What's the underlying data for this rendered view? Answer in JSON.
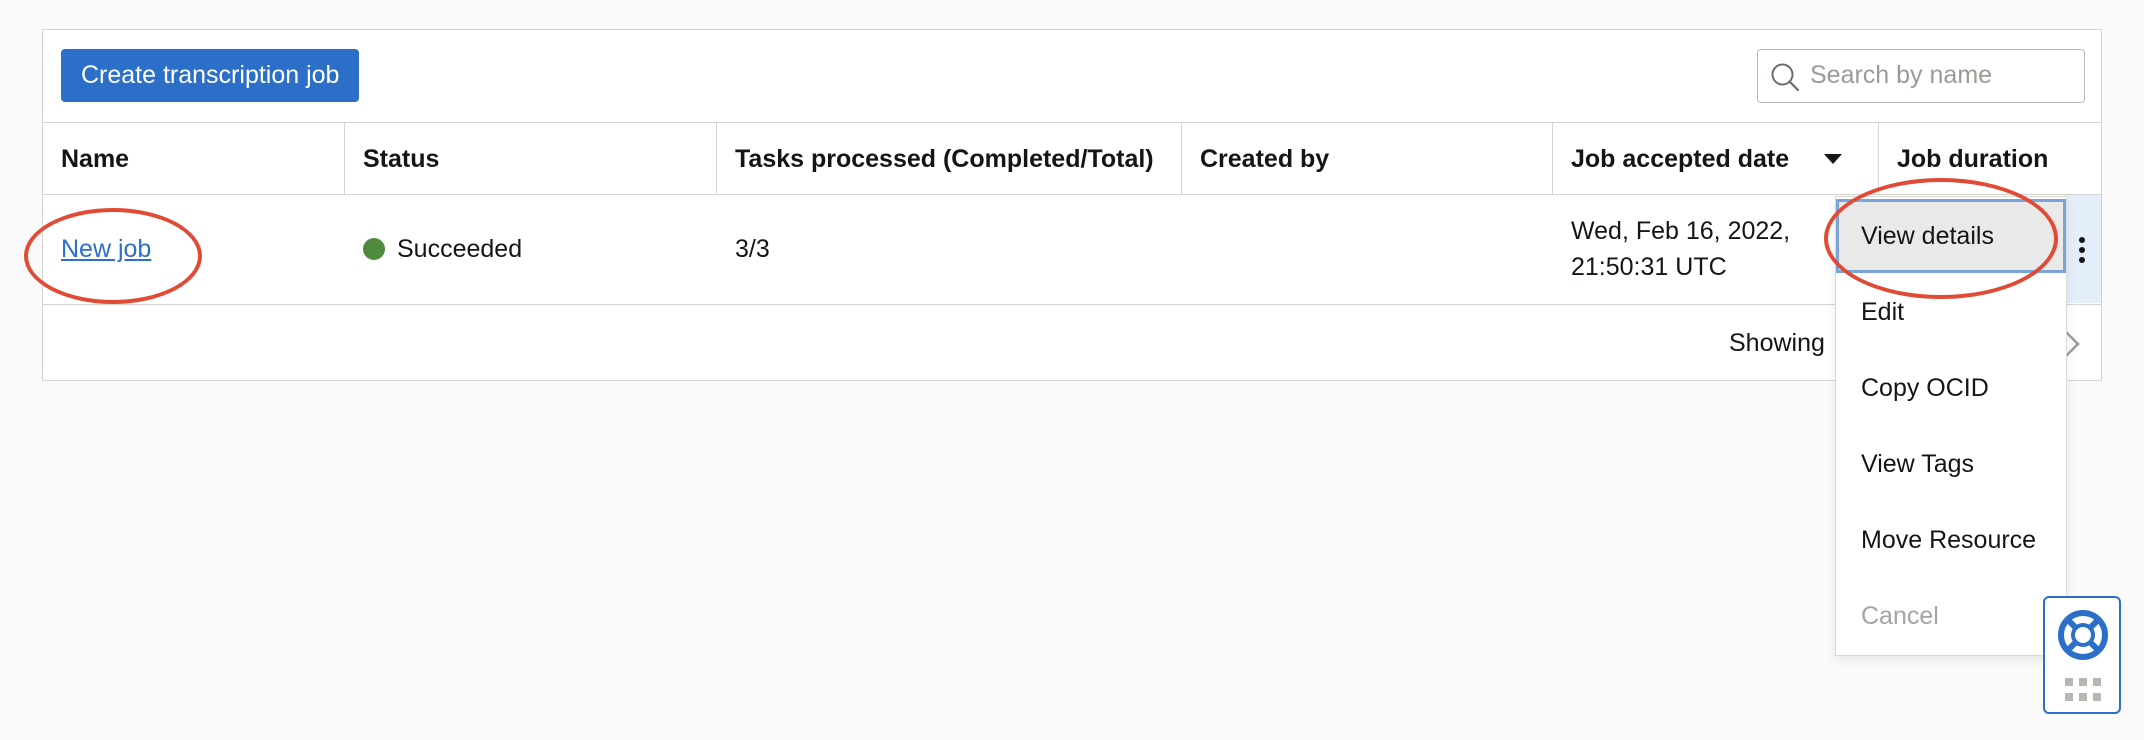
{
  "toolbar": {
    "create_label": "Create transcription job",
    "search_placeholder": "Search by name"
  },
  "table": {
    "columns": [
      "Name",
      "Status",
      "Tasks processed (Completed/Total)",
      "Created by",
      "Job accepted date",
      "Job duration"
    ],
    "rows": [
      {
        "name": "New job",
        "status": "Succeeded",
        "tasks": "3/3",
        "created_by": "",
        "accepted_date_line1": "Wed, Feb 16, 2022,",
        "accepted_date_line2": "21:50:31 UTC",
        "duration": ""
      }
    ],
    "footer_text": "Showing"
  },
  "action_menu": {
    "items": [
      "View details",
      "Edit",
      "Copy OCID",
      "View Tags",
      "Move Resource",
      "Cancel"
    ],
    "active_item": "View details",
    "disabled_item": "Cancel"
  },
  "colors": {
    "primary": "#2c6fc9",
    "success": "#508a3f",
    "callout": "#e14a35"
  },
  "icons": [
    "search-icon",
    "sort-desc-icon",
    "kebab-menu-icon",
    "chevron-right-icon",
    "lifebuoy-icon",
    "grid-icon"
  ]
}
